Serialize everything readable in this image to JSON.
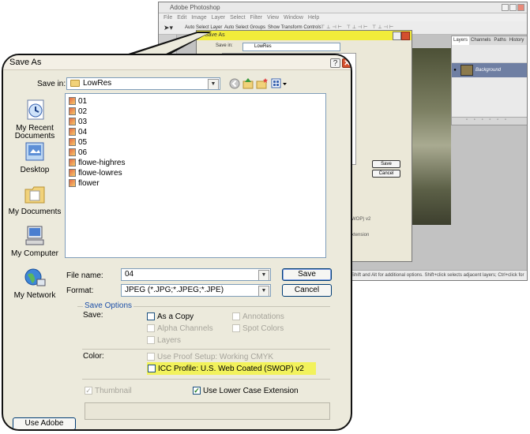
{
  "background_app": {
    "title": "Adobe Photoshop",
    "menu": "File Edit Image Layer Select Filter View Window Help",
    "options": [
      "Auto Select Layer",
      "Auto Select Groups",
      "Show Transform Controls"
    ],
    "layers_tabs": [
      "Layers",
      "Channels",
      "Paths",
      "History"
    ],
    "layer_name": "Background",
    "status_text": "Click and drag to move layer or selection. Use Shift and Alt for additional options. Shift+click selects adjacent layers; Ctrl+click for multi-selects; Alt+click digs; Ctrl+click selects in a group",
    "small_dialog": {
      "title": "Save As",
      "save_in_label": "Save in:",
      "folder": "LowRes",
      "save_label": "Save",
      "cancel_label": "Cancel",
      "icc_text": "(SWOP) v2",
      "ext_text": "Extension"
    }
  },
  "dialog": {
    "title": "Save As",
    "help_label": "?",
    "close_label": "✕",
    "save_in_label": "Save in:",
    "save_in_value": "LowRes",
    "places": [
      {
        "label": "My Recent Documents",
        "icon": "recent-documents-icon"
      },
      {
        "label": "Desktop",
        "icon": "desktop-icon"
      },
      {
        "label": "My Documents",
        "icon": "my-documents-icon"
      },
      {
        "label": "My Computer",
        "icon": "my-computer-icon"
      },
      {
        "label": "My Network",
        "icon": "my-network-icon"
      }
    ],
    "files": [
      "01",
      "02",
      "03",
      "04",
      "05",
      "06",
      "flowe-highres",
      "flowe-lowres",
      "flower"
    ],
    "file_name_label": "File name:",
    "file_name_value": "04",
    "format_label": "Format:",
    "format_value": "JPEG (*.JPG;*.JPEG;*.JPE)",
    "save_button": "Save",
    "cancel_button": "Cancel",
    "save_options_title": "Save Options",
    "save_label": "Save:",
    "options": {
      "as_copy": "As a Copy",
      "annotations": "Annotations",
      "alpha_channels": "Alpha Channels",
      "spot_colors": "Spot Colors",
      "layers": "Layers"
    },
    "color_label": "Color:",
    "use_proof": "Use Proof Setup:  Working CMYK",
    "icc_profile": "ICC Profile:  U.S. Web Coated (SWOP) v2",
    "thumbnail": "Thumbnail",
    "lowercase_ext": "Use Lower Case Extension",
    "adobe_dialog_button": "Use Adobe Dialog",
    "highlight_color": "#f2f25c"
  }
}
